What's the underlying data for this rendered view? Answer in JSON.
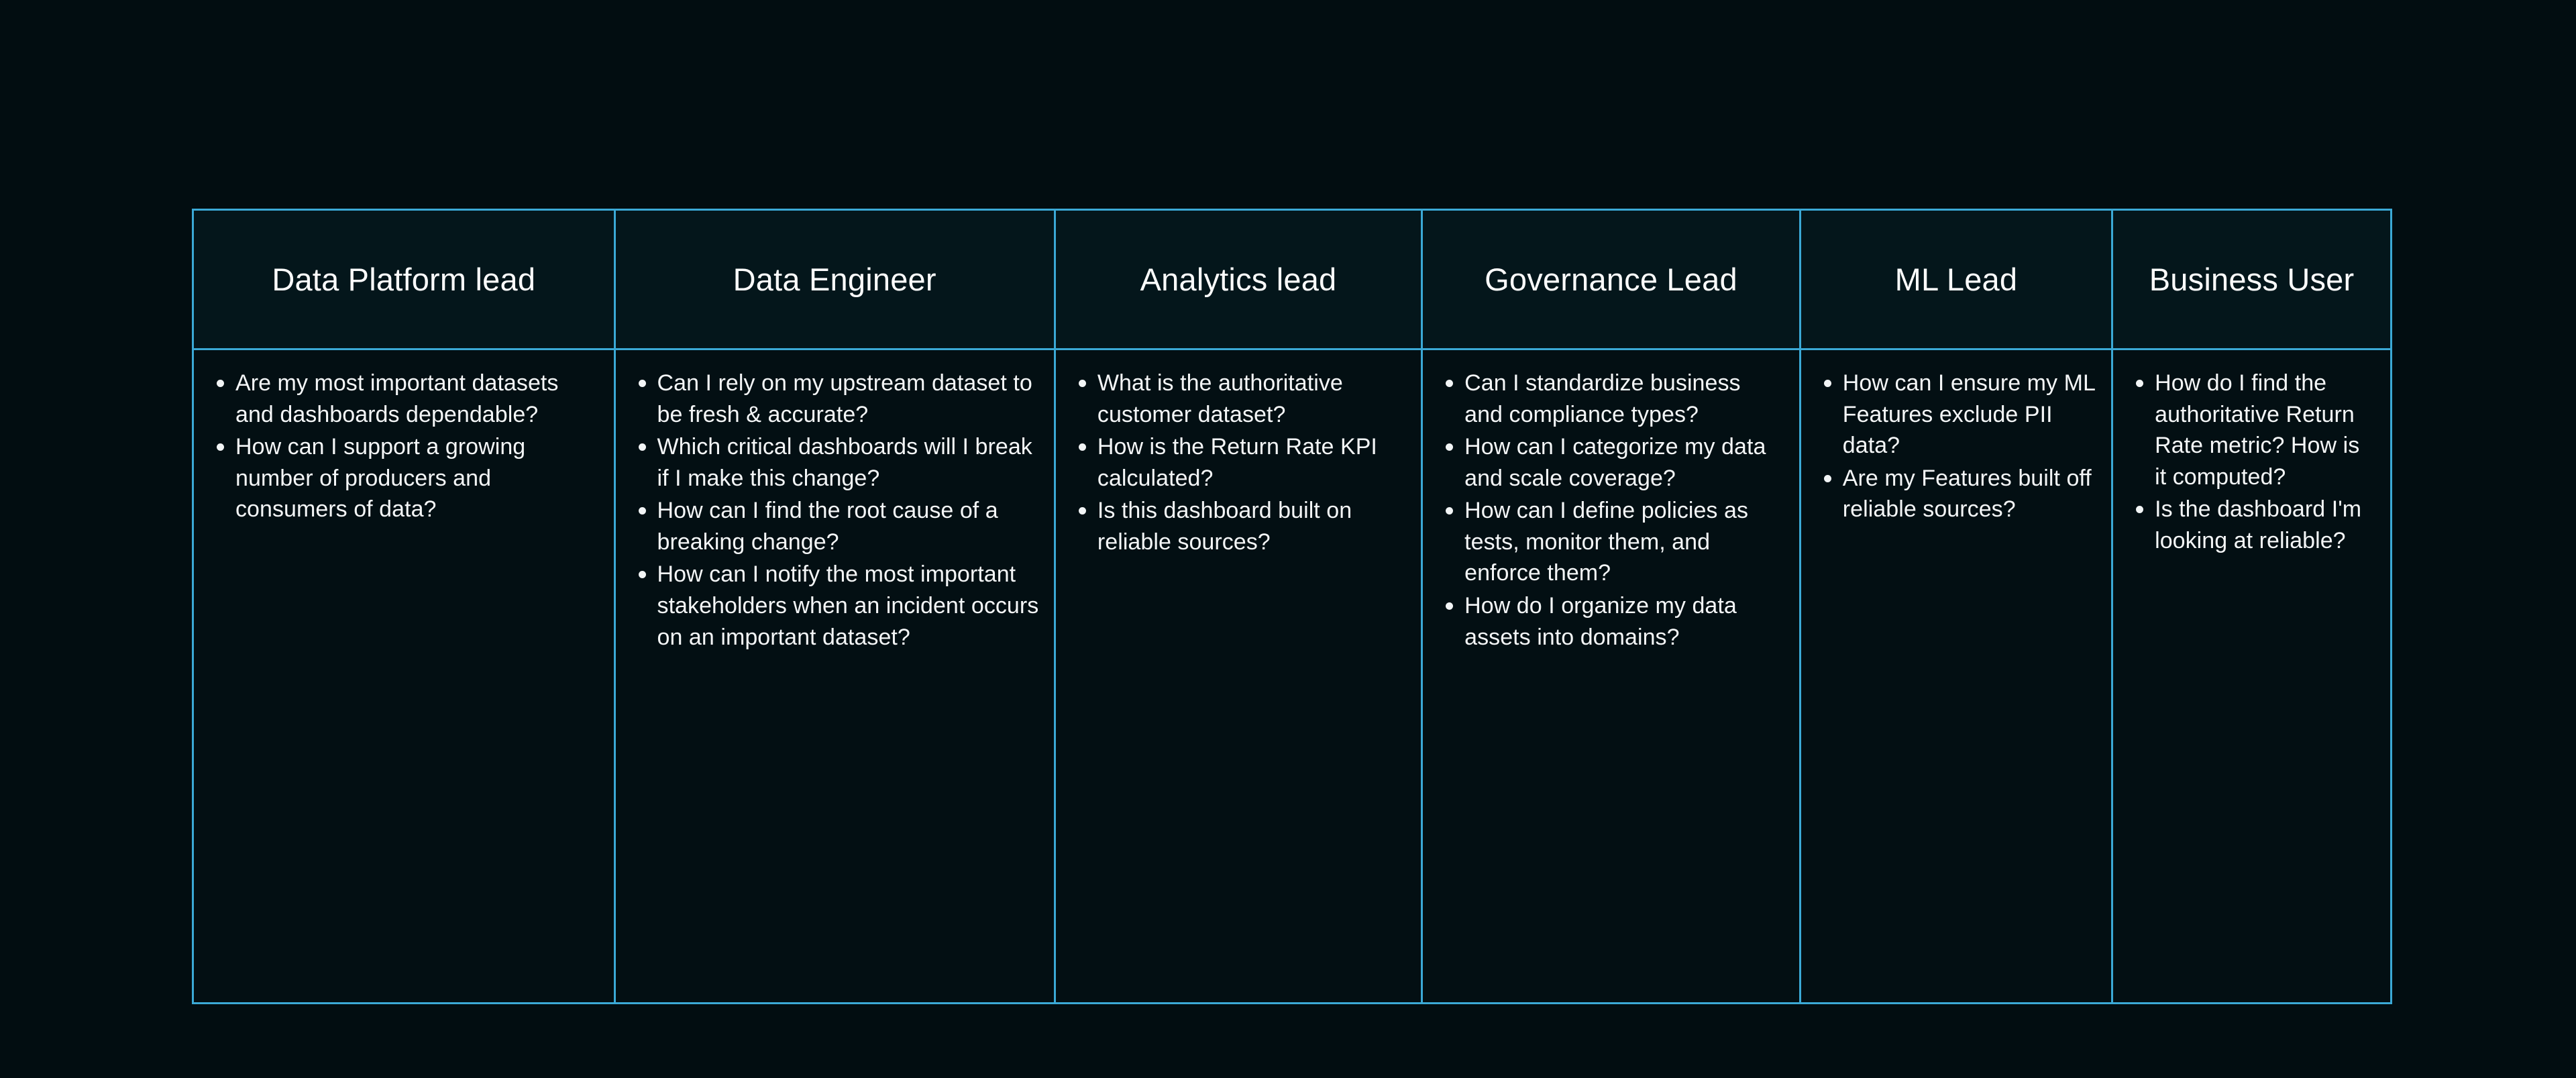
{
  "table": {
    "columns": [
      {
        "id": "data-platform-lead",
        "header": "Data Platform lead",
        "questions": [
          "Are my most important datasets and dashboards dependable?",
          "How can I support a growing number of producers and consumers of data?"
        ]
      },
      {
        "id": "data-engineer",
        "header": "Data Engineer",
        "questions": [
          "Can I rely on my upstream dataset to be fresh & accurate?",
          "Which critical dashboards will I break if I make this change?",
          "How can I find the root cause of a breaking change?",
          "How can I notify the most important stakeholders when an incident occurs on an important dataset?"
        ]
      },
      {
        "id": "analytics-lead",
        "header": "Analytics lead",
        "questions": [
          "What is the authoritative customer dataset?",
          "How is the Return Rate KPI calculated?",
          "Is this dashboard built on reliable sources?"
        ]
      },
      {
        "id": "governance-lead",
        "header": "Governance Lead",
        "questions": [
          "Can I standardize business and compliance types?",
          "How can I categorize my data and scale coverage?",
          "How can I define policies as tests, monitor them, and enforce them?",
          "How do I organize my data assets into domains?"
        ]
      },
      {
        "id": "ml-lead",
        "header": "ML Lead",
        "questions": [
          "How can I ensure my ML Features exclude PII data?",
          "Are my Features built off reliable sources?"
        ]
      },
      {
        "id": "business-user",
        "header": "Business User",
        "questions": [
          "How do I find the authoritative Return Rate metric? How is it computed?",
          "Is the dashboard I'm looking at reliable?"
        ]
      }
    ]
  },
  "colors": {
    "background": "#020d11",
    "border": "#3ba9d6",
    "header_cell_background": "#04161b",
    "body_cell_background": "#030f13",
    "text": "#f4f6f7"
  }
}
